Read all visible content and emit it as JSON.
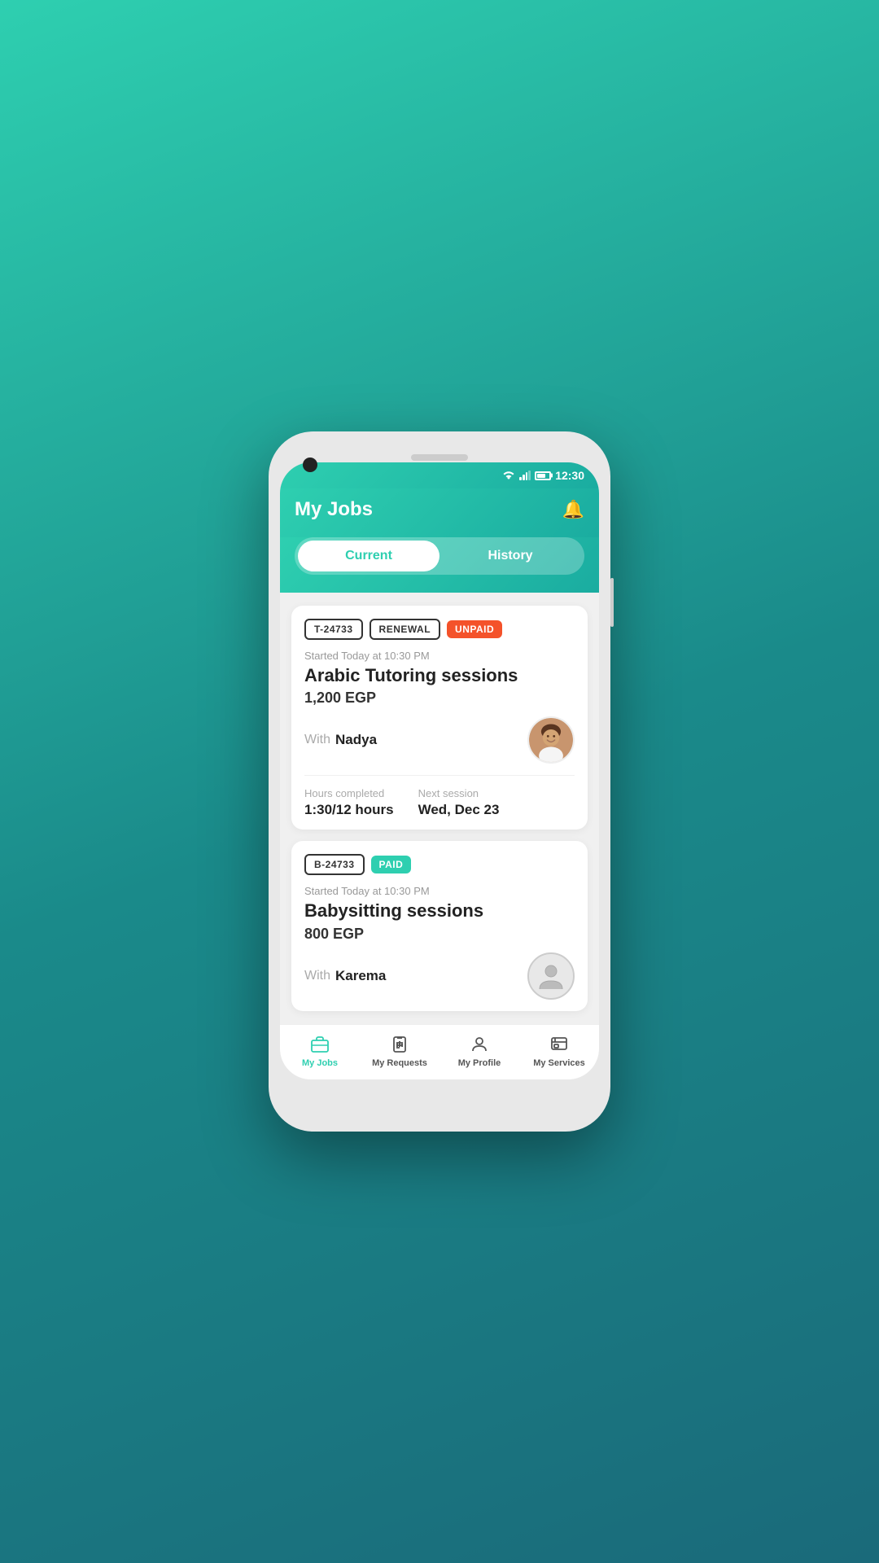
{
  "status_bar": {
    "time": "12:30"
  },
  "header": {
    "title": "My Jobs"
  },
  "tabs": {
    "current_label": "Current",
    "history_label": "History"
  },
  "jobs": [
    {
      "id": "T-24733",
      "type": "RENEWAL",
      "status": "UNPAID",
      "status_type": "unpaid",
      "started": "Started Today at 10:30 PM",
      "title": "Arabic Tutoring sessions",
      "price": "1,200 EGP",
      "with_label": "With",
      "provider_name": "Nadya",
      "hours_completed_label": "Hours completed",
      "hours_completed": "1:30/12 hours",
      "next_session_label": "Next session",
      "next_session": "Wed, Dec 23",
      "has_stats": true,
      "avatar_type": "person"
    },
    {
      "id": "B-24733",
      "type": null,
      "status": "PAID",
      "status_type": "paid",
      "started": "Started Today at 10:30 PM",
      "title": "Babysitting sessions",
      "price": "800 EGP",
      "with_label": "With",
      "provider_name": "Karema",
      "has_stats": false,
      "avatar_type": "placeholder"
    }
  ],
  "bottom_nav": [
    {
      "label": "My Jobs",
      "icon": "briefcase",
      "active": true
    },
    {
      "label": "My Requests",
      "icon": "clipboard",
      "active": false
    },
    {
      "label": "My Profile",
      "icon": "person",
      "active": false
    },
    {
      "label": "My Services",
      "icon": "services",
      "active": false
    }
  ]
}
